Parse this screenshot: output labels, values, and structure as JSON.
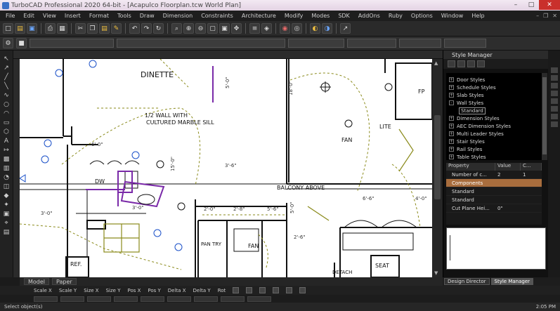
{
  "window": {
    "title": "TurboCAD Professional 2020 64-bit - [Acapulco Floorplan.tcw World Plan]"
  },
  "menu": [
    "File",
    "Edit",
    "View",
    "Insert",
    "Format",
    "Tools",
    "Draw",
    "Dimension",
    "Constraints",
    "Architecture",
    "Modify",
    "Modes",
    "SDK",
    "AddOns",
    "Ruby",
    "Options",
    "Window",
    "Help"
  ],
  "drawing": {
    "labels": {
      "dinette": "DINETTE",
      "half_wall_1": "1/2 WALL WITH",
      "half_wall_2": "CULTURED MARBLE SILL",
      "dw": "DW",
      "fan1": "FAN",
      "fan2": "FAN",
      "fp": "FP",
      "lite": "LITE",
      "balcony": "BALCONY ABOVE",
      "ref": "REF.",
      "seat": "SEAT",
      "pan_try": "PAN TRY",
      "detach": "DETACH",
      "d_5_0": "5'-0\"",
      "d_6_0": "6'-0\"",
      "d_3_0a": "3'-0\"",
      "d_3_0b": "3'-0\"",
      "d_3_6": "3'-6\"",
      "d_2_0": "2'-0\"",
      "d_2_8": "2'-8\"",
      "d_5_6": "5'-6\"",
      "d_4_0": "4'-0\"",
      "d_18_0": "18'-0\"",
      "d_5_0v": "5'-0\"",
      "d_15_0": "15'-0\"",
      "d_6_6": "6'-6\"",
      "d_2_6": "2'-6\""
    }
  },
  "tabs": {
    "model": "Model",
    "paper": "Paper"
  },
  "style_manager": {
    "title": "Style Manager",
    "tree": [
      {
        "label": "Door Styles"
      },
      {
        "label": "Schedule Styles"
      },
      {
        "label": "Slab Styles"
      },
      {
        "label": "Wall Styles"
      },
      {
        "label": "Standard",
        "child": true
      },
      {
        "label": "Dimension Styles"
      },
      {
        "label": "AEC Dimension Styles"
      },
      {
        "label": "Multi Leader Styles"
      },
      {
        "label": "Stair Styles"
      },
      {
        "label": "Rail Styles"
      },
      {
        "label": "Table Styles"
      }
    ],
    "props_header": [
      "Property",
      "Value",
      "C..."
    ],
    "props": [
      {
        "name": "Number of c...",
        "value": "2",
        "extra": "1"
      },
      {
        "name": "Components",
        "value": "",
        "extra": "",
        "highlight": true
      },
      {
        "name": "Standard",
        "value": "",
        "extra": ""
      },
      {
        "name": "Standard",
        "value": "",
        "extra": ""
      },
      {
        "name": "Cut Plane Hei...",
        "value": "0\"",
        "extra": ""
      }
    ],
    "tabs": [
      "Design Director",
      "Style Manager"
    ]
  },
  "coord_labels": [
    "Scale X",
    "Scale Y",
    "Size X",
    "Size Y",
    "Pos X",
    "Pos Y",
    "Delta X",
    "Delta Y",
    "Rot"
  ],
  "status": {
    "prompt": "Select object(s)",
    "time": "2:05 PM"
  },
  "colors": {
    "accent": "#a86d3d",
    "canvas_bg": "#ffffff",
    "wall": "#111111",
    "wall_purple": "#7a2aa8",
    "dash_olive": "#8a8a1a",
    "blue_ref": "#1a50c8"
  }
}
